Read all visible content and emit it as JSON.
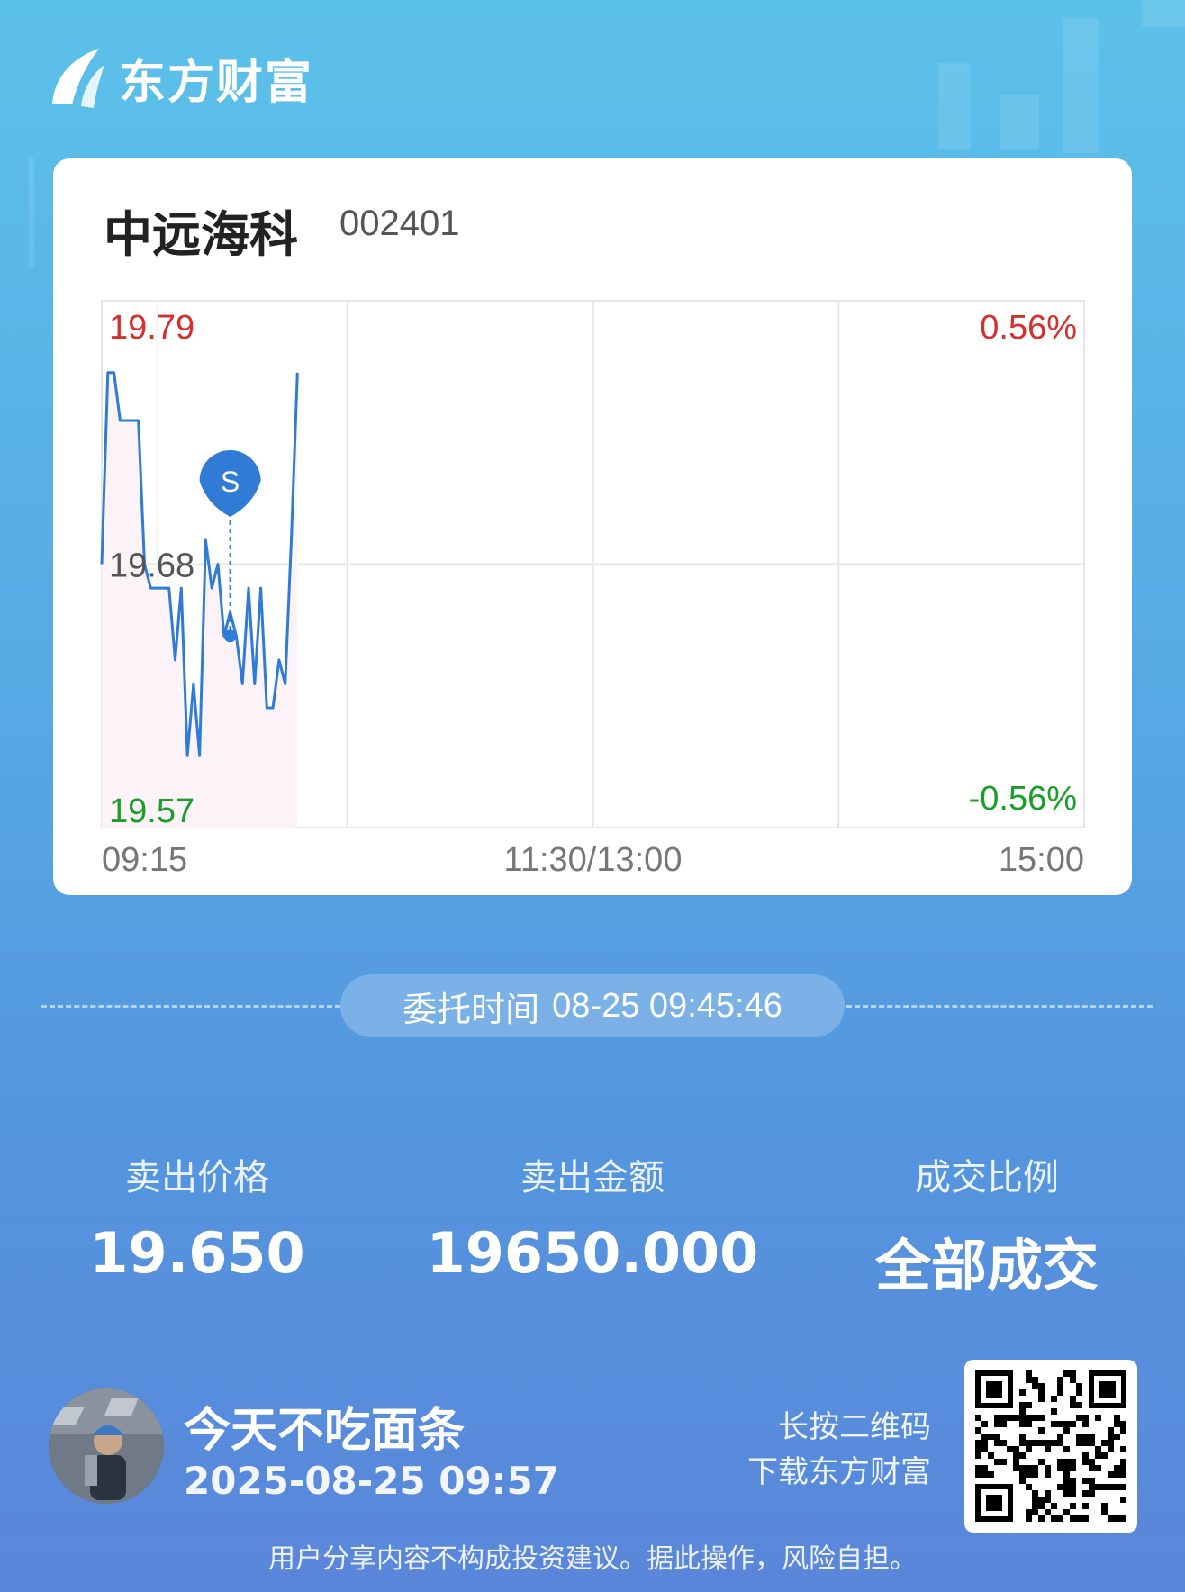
{
  "brand": {
    "name": "东方财富"
  },
  "stock": {
    "name": "中远海科",
    "code": "002401"
  },
  "chart_data": {
    "type": "line",
    "series": [
      {
        "values": [
          19.68,
          19.76,
          19.76,
          19.74,
          19.74,
          19.74,
          19.74,
          19.68,
          19.67,
          19.67,
          19.67,
          19.67,
          19.64,
          19.67,
          19.6,
          19.63,
          19.6,
          19.69,
          19.67,
          19.68,
          19.65,
          19.66,
          19.65,
          19.63,
          19.67,
          19.63,
          19.67,
          19.62,
          19.62,
          19.64,
          19.63,
          19.69,
          19.76
        ]
      }
    ],
    "x_ticks": [
      "09:15",
      "11:30/13:00",
      "15:00"
    ],
    "price_labels": {
      "top": "19.79",
      "mid": "19.68",
      "bottom": "19.57"
    },
    "pct_labels": {
      "top": "0.56%",
      "bottom": "-0.56%"
    },
    "ylim": [
      19.57,
      19.79
    ],
    "marker": {
      "label": "S",
      "price": 19.65
    },
    "colors": {
      "line": "#2f7bd6",
      "up": "#d43030",
      "down": "#1a9e2a",
      "grid": "#e6e6e6",
      "marker": "#2f7bd6"
    },
    "grid": true
  },
  "order": {
    "label": "委托时间",
    "time": "08-25 09:45:46"
  },
  "stats": [
    {
      "label": "卖出价格",
      "value": "19.650"
    },
    {
      "label": "卖出金额",
      "value": "19650.000"
    },
    {
      "label": "成交比例",
      "value": "全部成交"
    }
  ],
  "user": {
    "name": "今天不吃面条",
    "time": "2025-08-25 09:57"
  },
  "qr_hint": {
    "line1": "长按二维码",
    "line2": "下载东方财富"
  },
  "disclaimer": "用户分享内容不构成投资建议。据此操作，风险自担。"
}
